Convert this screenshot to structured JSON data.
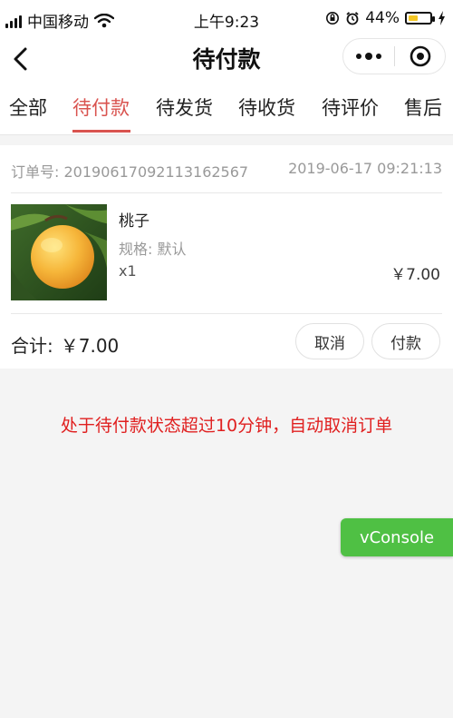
{
  "status_bar": {
    "carrier": "中国移动",
    "time": "上午9:23",
    "battery": "44%",
    "battery_level": 0.44,
    "icons": [
      "signal-icon",
      "wifi-icon",
      "orientation-lock-icon",
      "alarm-icon",
      "battery-icon",
      "charging-icon"
    ]
  },
  "nav": {
    "title": "待付款",
    "icons": [
      "back-chevron-icon",
      "more-dots-icon",
      "target-icon"
    ]
  },
  "tabs": [
    {
      "label": "全部",
      "active": false
    },
    {
      "label": "待付款",
      "active": true
    },
    {
      "label": "待发货",
      "active": false
    },
    {
      "label": "待收货",
      "active": false
    },
    {
      "label": "待评价",
      "active": false
    },
    {
      "label": "售后",
      "active": false
    }
  ],
  "order": {
    "number_label": "订单号:",
    "number": "20190617092113162567",
    "time": "2019-06-17 09:21:13",
    "item": {
      "name": "桃子",
      "spec_label": "规格:",
      "spec": "默认",
      "qty": "x1",
      "price": "￥7.00"
    },
    "total_label": "合计:",
    "total": "￥7.00",
    "cancel_label": "取消",
    "pay_label": "付款"
  },
  "notice": "处于待付款状态超过10分钟，自动取消订单",
  "vconsole_label": "vConsole",
  "colors": {
    "accent": "#d9534f",
    "notice": "#e02020",
    "vconsole": "#4fc044",
    "battery": "#f3c623"
  }
}
